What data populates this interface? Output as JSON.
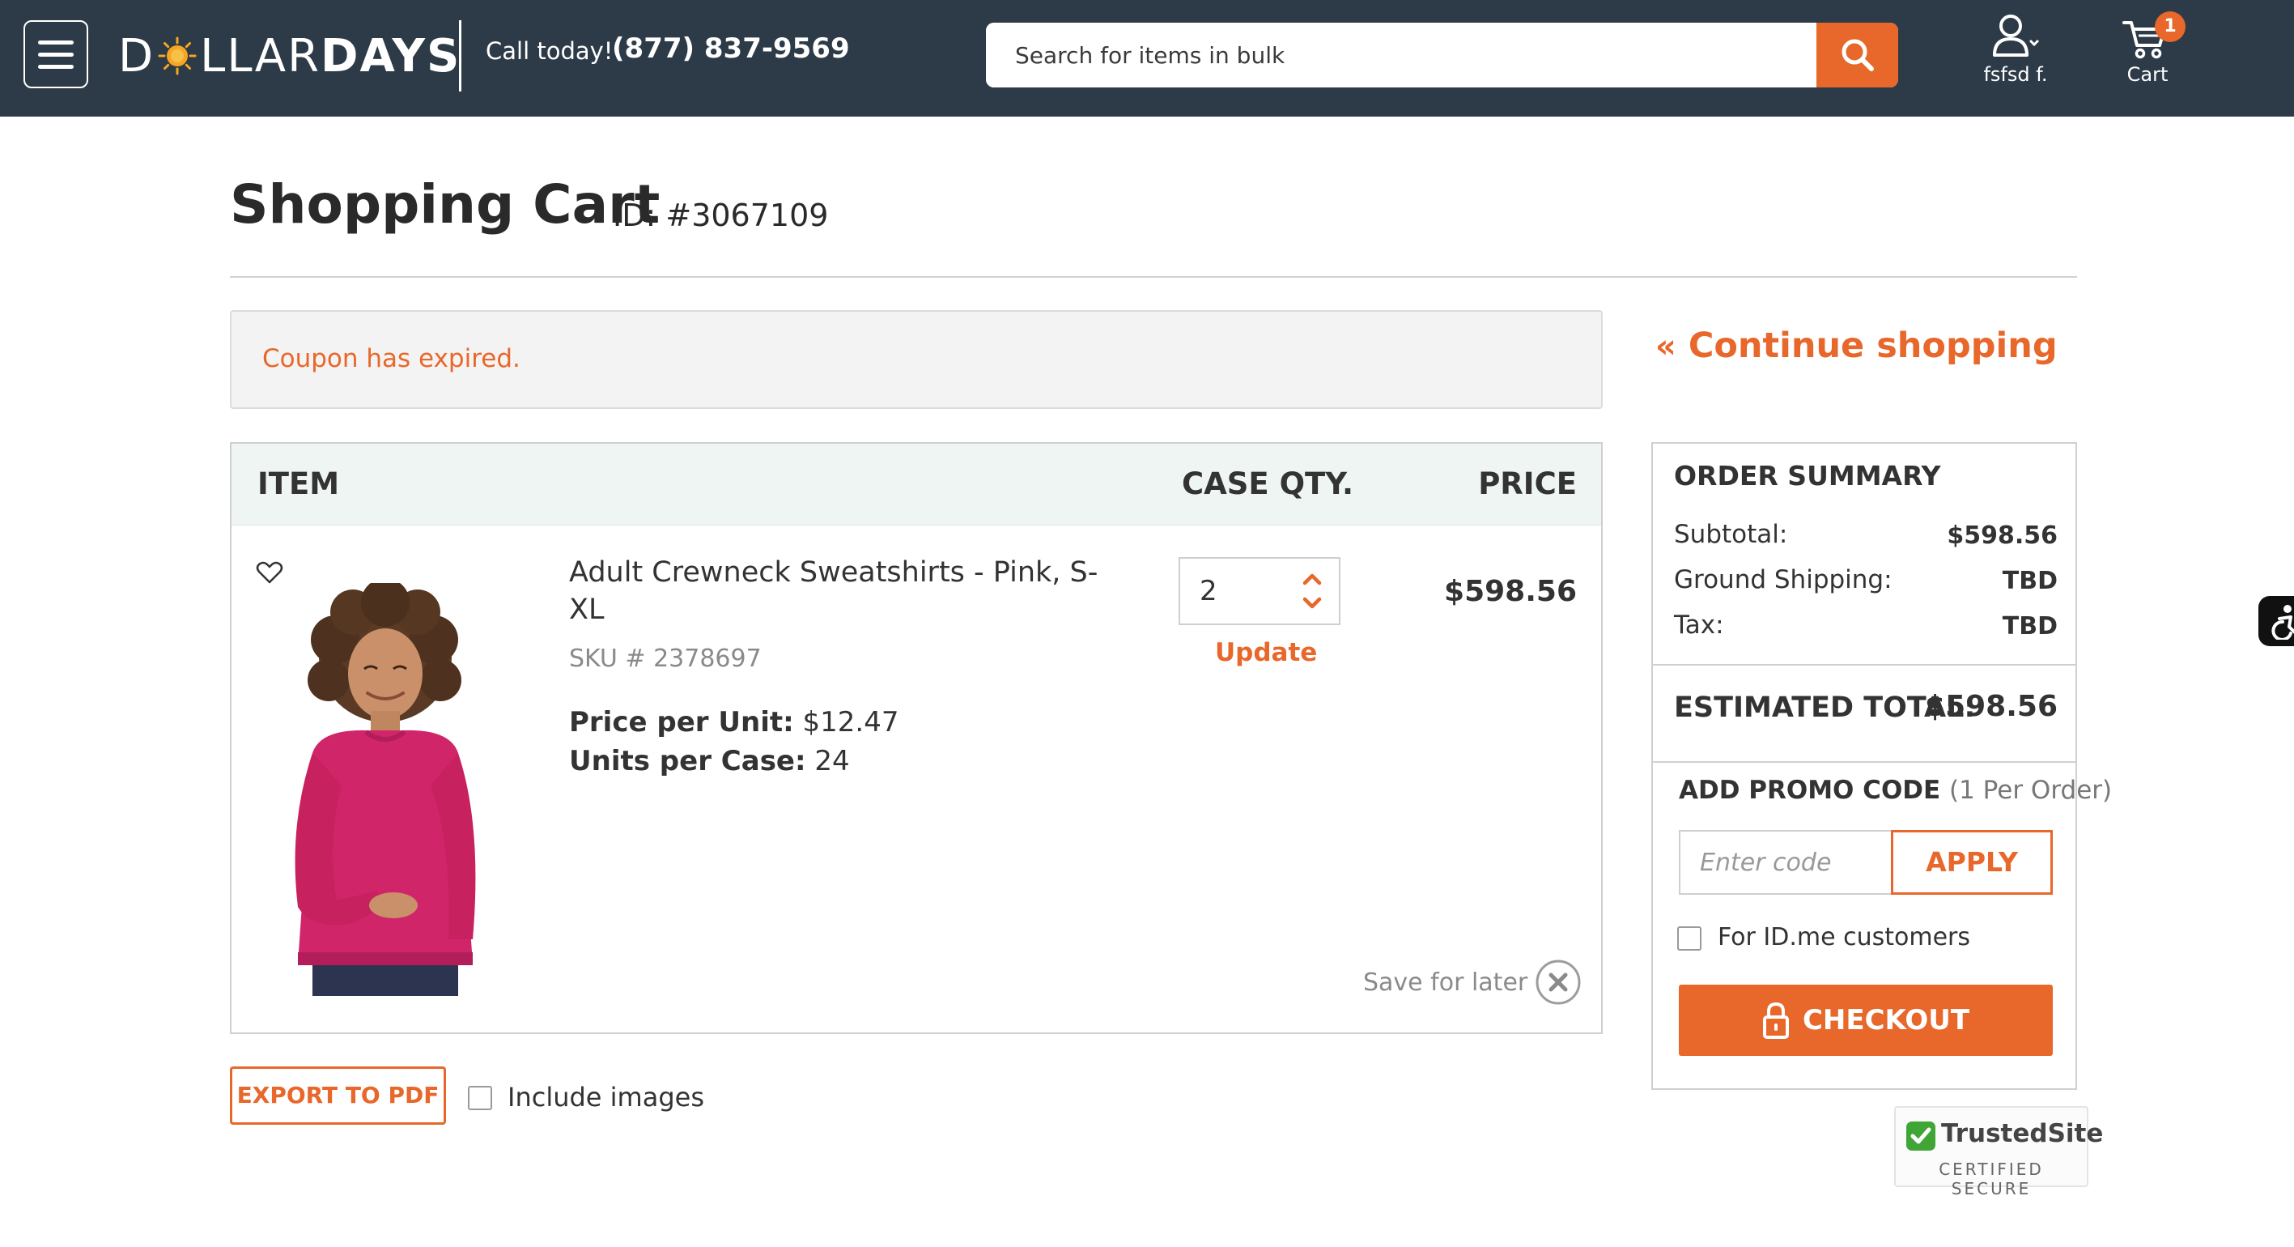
{
  "header": {
    "logo_prefix": "D",
    "logo_middle": "LLAR",
    "logo_suffix": "DAYS",
    "call_label": "Call today!",
    "phone": "(877) 837-9569",
    "search_placeholder": "Search for items in bulk",
    "account_label": "fsfsd f.",
    "cart_label": "Cart",
    "cart_count": "1"
  },
  "page": {
    "title": "Shopping Cart",
    "cart_id": "ID: #3067109",
    "alert": "Coupon has expired.",
    "continue_label": "Continue shopping"
  },
  "cart": {
    "columns": {
      "item": "ITEM",
      "qty": "CASE QTY.",
      "price": "PRICE"
    },
    "item": {
      "name": "Adult Crewneck Sweatshirts - Pink, S-XL",
      "sku": "SKU # 2378697",
      "price_per_unit_label": "Price per Unit:",
      "price_per_unit": "$12.47",
      "units_per_case_label": "Units per Case:",
      "units_per_case": "24",
      "qty": "2",
      "update_label": "Update",
      "price": "$598.56",
      "save_for_later": "Save for later"
    },
    "export_label": "EXPORT TO PDF",
    "include_images_label": "Include images"
  },
  "summary": {
    "title": "ORDER SUMMARY",
    "subtotal_label": "Subtotal:",
    "subtotal": "$598.56",
    "shipping_label": "Ground Shipping:",
    "shipping": "TBD",
    "tax_label": "Tax:",
    "tax": "TBD",
    "estimated_label": "ESTIMATED TOTAL:",
    "estimated": "$598.56",
    "promo_label": "ADD PROMO CODE",
    "promo_note": "(1 Per Order)",
    "promo_placeholder": "Enter code",
    "apply_label": "APPLY",
    "idme_label": "For ID.me customers",
    "checkout_label": "CHECKOUT"
  },
  "trust": {
    "name": "TrustedSite",
    "sub": "CERTIFIED SECURE"
  },
  "colors": {
    "accent": "#e8672a",
    "header_bg": "#2d3a47",
    "table_header_bg": "#eef5f3"
  }
}
